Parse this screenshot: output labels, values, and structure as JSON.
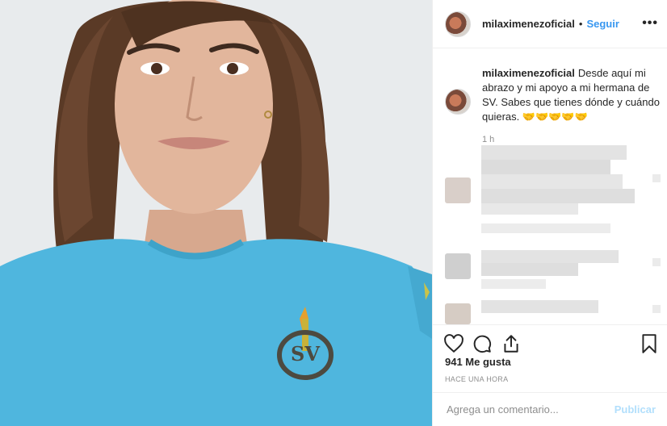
{
  "post": {
    "username": "milaximenezoficial",
    "follow_label": "Seguir",
    "dot": "•",
    "more_label": "•••",
    "caption": {
      "username": "milaximenezoficial",
      "text": "Desde aquí mi abrazo y mi apoyo a mi hermana de SV. Sabes que tienes dónde y cuándo quieras. 🤝🤝🤝🤝🤝",
      "time": "1 h"
    },
    "photo": {
      "shirt_logo": "SV"
    },
    "likes": "941 Me gusta",
    "time_ago": "Hace una hora",
    "comment_placeholder": "Agrega un comentario...",
    "post_button": "Publicar"
  },
  "icons": {
    "like": "heart-icon",
    "comment": "speech-bubble-icon",
    "share": "share-icon",
    "save": "bookmark-icon"
  },
  "colors": {
    "accent": "#3897f0",
    "post_disabled": "#b2dffc",
    "shirt": "#4fb6de",
    "text": "#262626",
    "muted": "#8e8e8e"
  }
}
